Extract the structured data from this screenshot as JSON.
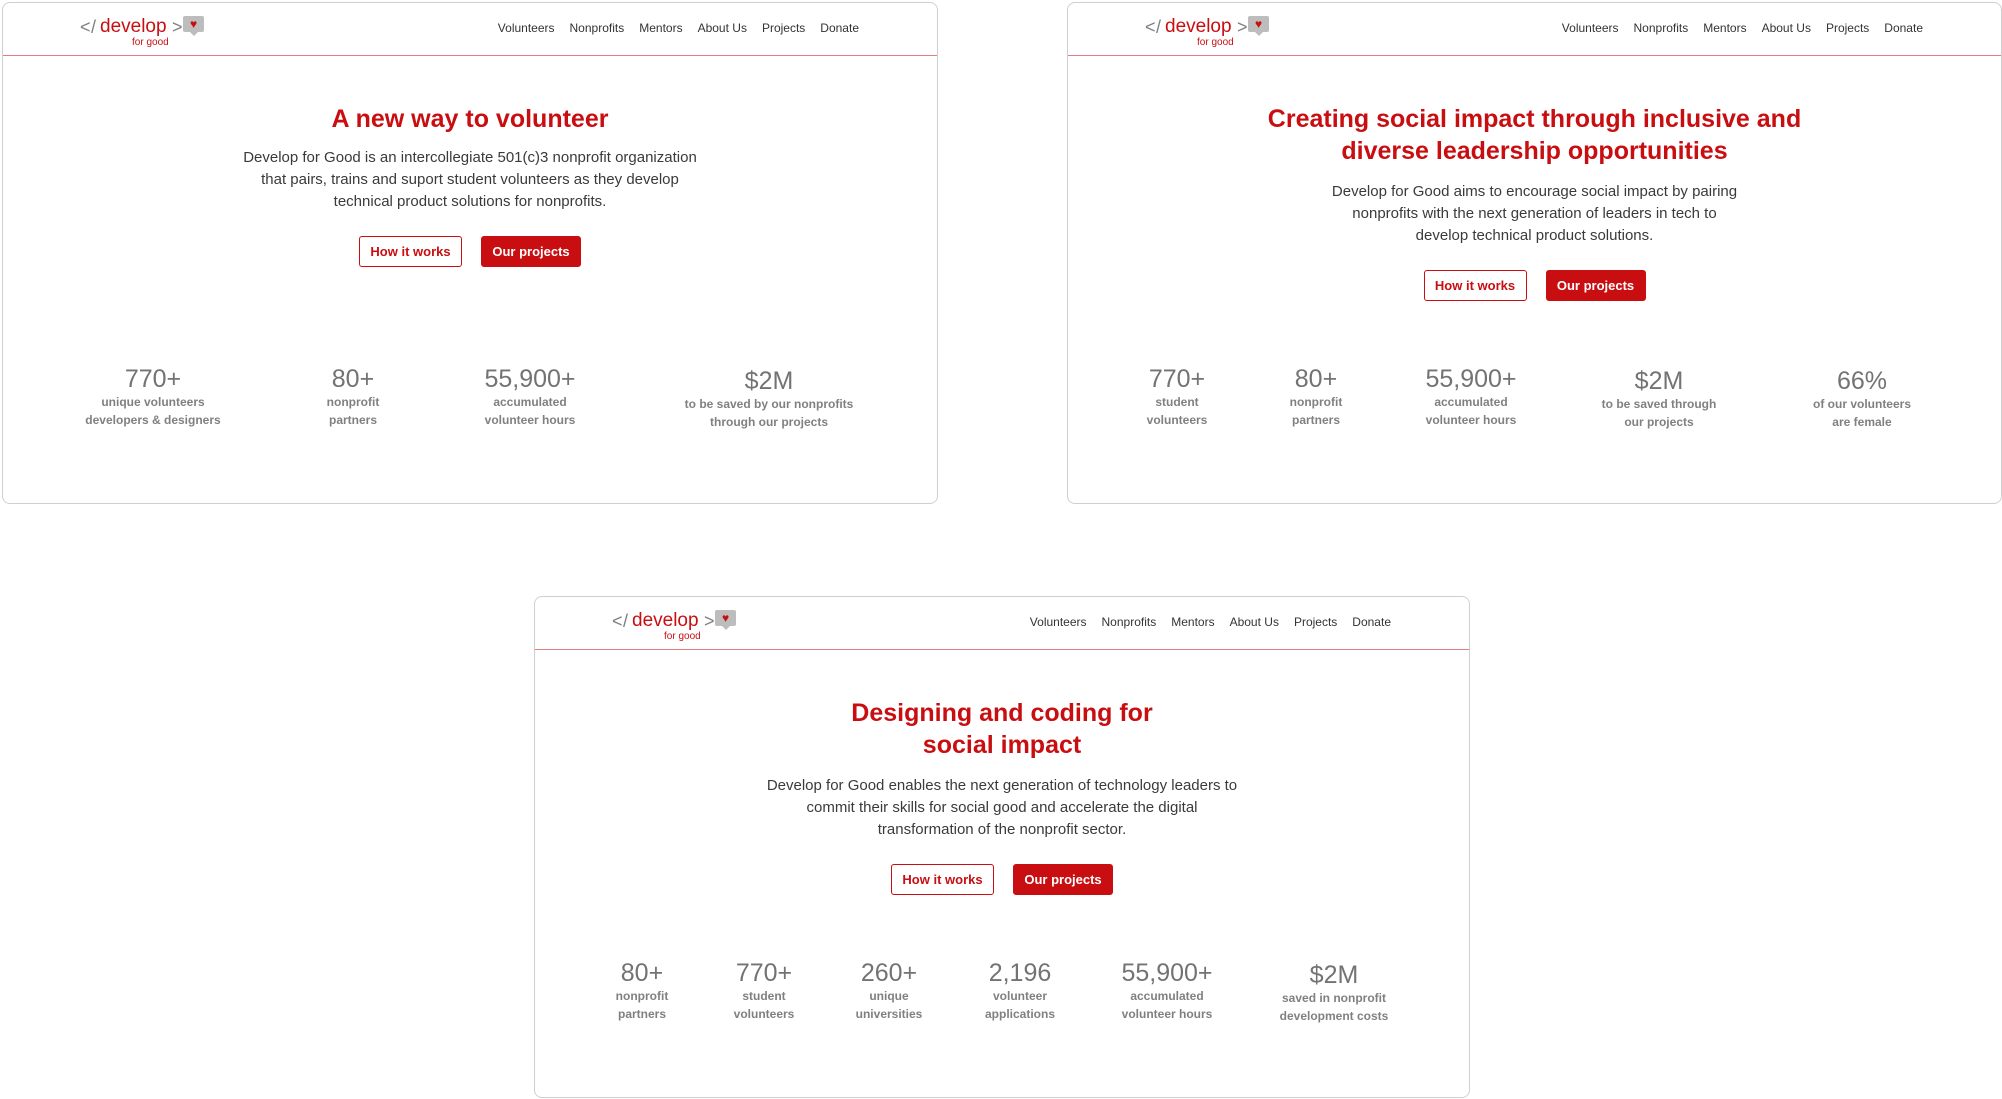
{
  "logo": {
    "open": "</",
    "word": "develop",
    "close": ">",
    "sub": "for good",
    "heart": "♥"
  },
  "nav": [
    "Volunteers",
    "Nonprofits",
    "Mentors",
    "About Us",
    "Projects",
    "Donate"
  ],
  "buttons": {
    "how": "How it works",
    "projects": "Our projects"
  },
  "frames": [
    {
      "title": [
        "A new way to volunteer"
      ],
      "description": [
        "Develop for Good is an intercollegiate 501(c)3 nonprofit organization",
        "that pairs, trains and suport student volunteers as they develop",
        "technical product solutions for nonprofits."
      ],
      "stats": [
        {
          "value": "770+",
          "label": [
            "unique volunteers",
            "developers & designers"
          ]
        },
        {
          "value": "80+",
          "label": [
            "nonprofit",
            "partners"
          ]
        },
        {
          "value": "55,900+",
          "label": [
            "accumulated",
            "volunteer hours"
          ]
        },
        {
          "value": "$2M",
          "label": [
            "to be saved by our nonprofits",
            "through our projects"
          ]
        }
      ]
    },
    {
      "title": [
        "Creating social impact through inclusive and",
        "diverse leadership opportunities"
      ],
      "description": [
        "Develop for Good aims to encourage social impact by pairing",
        "nonprofits with the next generation of leaders in tech to",
        "develop technical product solutions."
      ],
      "stats": [
        {
          "value": "770+",
          "label": [
            "student",
            "volunteers"
          ]
        },
        {
          "value": "80+",
          "label": [
            "nonprofit",
            "partners"
          ]
        },
        {
          "value": "55,900+",
          "label": [
            "accumulated",
            "volunteer hours"
          ]
        },
        {
          "value": "$2M",
          "label": [
            "to be saved through",
            "our projects"
          ]
        },
        {
          "value": "66%",
          "label": [
            "of our volunteers",
            "are female"
          ]
        }
      ]
    },
    {
      "title": [
        "Designing and coding for",
        "social impact"
      ],
      "description": [
        "Develop for Good enables the next generation of technology leaders to",
        "commit their skills for social good and accelerate the digital",
        "transformation of the nonprofit sector."
      ],
      "stats": [
        {
          "value": "80+",
          "label": [
            "nonprofit",
            "partners"
          ]
        },
        {
          "value": "770+",
          "label": [
            "student",
            "volunteers"
          ]
        },
        {
          "value": "260+",
          "label": [
            "unique",
            "universities"
          ]
        },
        {
          "value": "2,196",
          "label": [
            "volunteer",
            "applications"
          ]
        },
        {
          "value": "55,900+",
          "label": [
            "accumulated",
            "volunteer hours"
          ]
        },
        {
          "value": "$2M",
          "label": [
            "saved in nonprofit",
            "development costs"
          ]
        }
      ]
    }
  ]
}
